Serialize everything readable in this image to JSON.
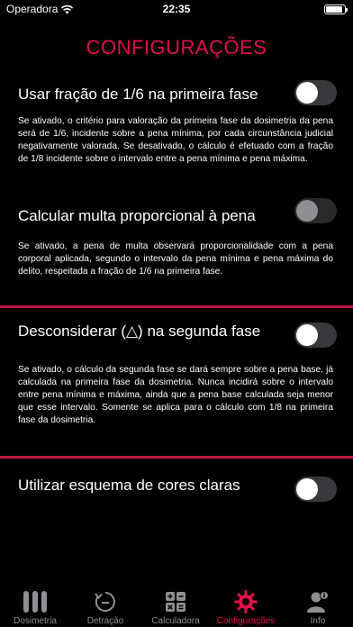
{
  "status_bar": {
    "carrier": "Operadora",
    "time": "22:35",
    "battery_level": 0.8
  },
  "title": "CONFIGURAÇÕES",
  "settings": [
    {
      "title": "Usar fração de 1/6 na primeira fase",
      "description": "Se ativado, o critério para valoração da primeira fase da dosimetria da pena será de 1/6, incidente sobre a pena mínima, por cada circunstância judicial negativamente valorada. Se desativado, o cálculo é efetuado com a fração de 1/8 incidente sobre o intervalo entre a pena mínima e pena máxima.",
      "enabled": false
    },
    {
      "title": "Calcular multa proporcional à pena",
      "description": "Se ativado, a pena de multa observará proporcionalidade com a pena corporal aplicada, segundo o intervalo da pena mínima e pena máxima do delito, respeitada a fração de 1/6 na primeira fase.",
      "enabled": false,
      "disabled": true
    },
    {
      "title": "Desconsiderar (△)  na segunda fase",
      "description": "Se ativado, o cálculo da segunda fase se dará sempre sobre a pena base, já calculada na primeira fase da dosimetria. Nunca incidirá sobre o intervalo entre pena mínima e máxima, ainda que a pena base calculada seja menor que esse intervalo. Somente se aplica para o cálculo com 1/8 na primeira fase da dosimetria.",
      "enabled": false
    },
    {
      "title": "Utilizar esquema  de cores claras",
      "enabled": false
    }
  ],
  "tabs": [
    {
      "label": "Dosimetria",
      "icon": "bars-icon"
    },
    {
      "label": "Detração",
      "icon": "timer-reverse-icon"
    },
    {
      "label": "Calculadora",
      "icon": "calculator-icon"
    },
    {
      "label": "Configurações",
      "icon": "gear-icon",
      "active": true
    },
    {
      "label": "Info",
      "icon": "person-info-icon"
    }
  ],
  "colors": {
    "accent": "#e11049",
    "divider": "#c0143f",
    "inactive": "#8e8e93"
  }
}
